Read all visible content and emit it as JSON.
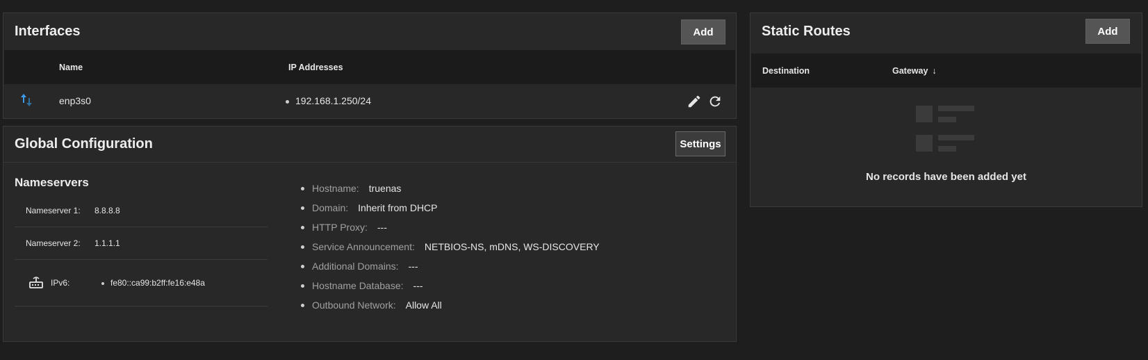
{
  "interfaces": {
    "title": "Interfaces",
    "add_label": "Add",
    "columns": [
      "Name",
      "IP Addresses"
    ],
    "rows": [
      {
        "name": "enp3s0",
        "ip": "192.168.1.250/24"
      }
    ]
  },
  "global_config": {
    "title": "Global Configuration",
    "settings_label": "Settings",
    "nameservers_heading": "Nameservers",
    "nameservers": [
      {
        "label": "Nameserver 1:",
        "value": "8.8.8.8"
      },
      {
        "label": "Nameserver 2:",
        "value": "1.1.1.1"
      }
    ],
    "ipv6": {
      "label": "IPv6:",
      "value": "fe80::ca99:b2ff:fe16:e48a"
    },
    "info": [
      {
        "key": "Hostname:",
        "value": "truenas"
      },
      {
        "key": "Domain:",
        "value": "Inherit from DHCP"
      },
      {
        "key": "HTTP Proxy:",
        "value": "---"
      },
      {
        "key": "Service Announcement:",
        "value": "NETBIOS-NS, mDNS, WS-DISCOVERY"
      },
      {
        "key": "Additional Domains:",
        "value": "---"
      },
      {
        "key": "Hostname Database:",
        "value": "---"
      },
      {
        "key": "Outbound Network:",
        "value": "Allow All"
      }
    ]
  },
  "static_routes": {
    "title": "Static Routes",
    "add_label": "Add",
    "columns": [
      "Destination",
      "Gateway"
    ],
    "sort_indicator": "↓",
    "empty_message": "No records have been added yet"
  },
  "colors": {
    "background": "#1e1e1e",
    "card": "#282828",
    "accent_blue": "#3d9be9"
  }
}
